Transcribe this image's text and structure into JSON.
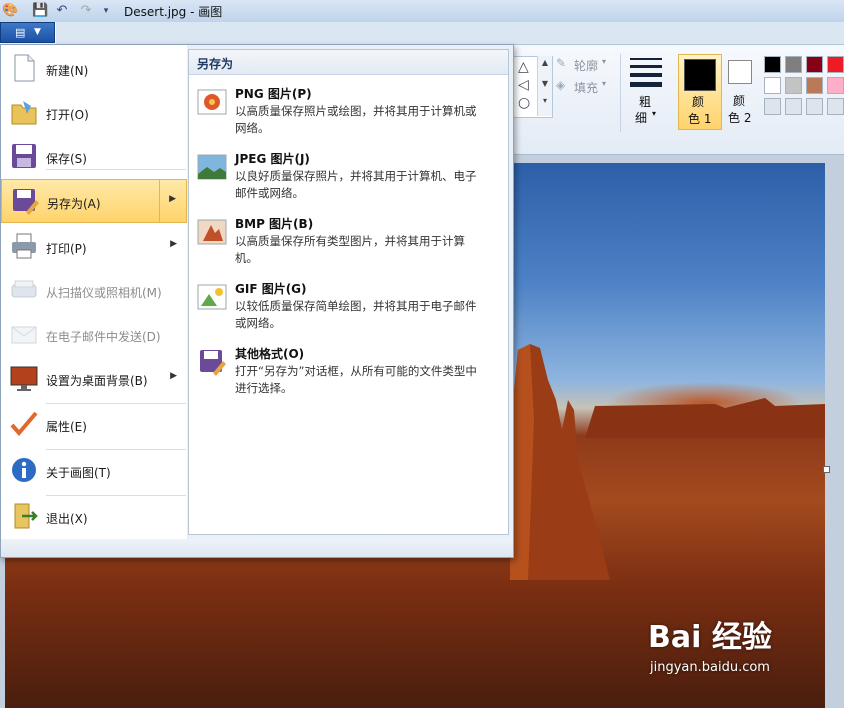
{
  "window": {
    "title": "Desert.jpg - 画图"
  },
  "quick_access": {
    "save_icon": "save-icon",
    "undo_icon": "undo-icon",
    "redo_icon": "redo-icon",
    "customize_icon": "chevron-down-icon"
  },
  "ribbon": {
    "outline_label": "轮廓",
    "fill_label": "填充",
    "size_label_1": "粗",
    "size_label_2": "细",
    "color1_label_1": "颜",
    "color1_label_2": "色 1",
    "color2_label_1": "颜",
    "color2_label_2": "色 2",
    "palette": [
      "#000000",
      "#7f7f7f",
      "#880015",
      "#ed1c24",
      "#ffffff",
      "#c3c3c3",
      "#b97a57",
      "#ffaec9",
      "#dde4ec",
      "#dde4ec",
      "#dde4ec",
      "#dde4ec"
    ],
    "color1": "#000000",
    "color2": "#ffffff"
  },
  "app_menu": {
    "items": [
      {
        "label": "新建(N)",
        "icon": "new-file-icon",
        "enabled": true
      },
      {
        "label": "打开(O)",
        "icon": "open-folder-icon",
        "enabled": true
      },
      {
        "label": "保存(S)",
        "icon": "save-icon",
        "enabled": true
      },
      {
        "label": "另存为(A)",
        "icon": "save-as-icon",
        "enabled": true,
        "active": true
      },
      {
        "label": "打印(P)",
        "icon": "printer-icon",
        "enabled": true
      },
      {
        "label": "从扫描仪或照相机(M)",
        "icon": "scanner-icon",
        "enabled": false
      },
      {
        "label": "在电子邮件中发送(D)",
        "icon": "email-icon",
        "enabled": false
      },
      {
        "label": "设置为桌面背景(B)",
        "icon": "desktop-background-icon",
        "enabled": true
      },
      {
        "label": "属性(E)",
        "icon": "checkmark-icon",
        "enabled": true
      },
      {
        "label": "关于画图(T)",
        "icon": "info-icon",
        "enabled": true
      },
      {
        "label": "退出(X)",
        "icon": "exit-icon",
        "enabled": true
      }
    ],
    "submenu": {
      "title": "另存为",
      "items": [
        {
          "title": "PNG 图片(P)",
          "desc": "以高质量保存照片或绘图，并将其用于计算机或网络。",
          "icon": "png-image-icon"
        },
        {
          "title": "JPEG 图片(J)",
          "desc": "以良好质量保存照片，并将其用于计算机、电子邮件或网络。",
          "icon": "jpeg-image-icon"
        },
        {
          "title": "BMP 图片(B)",
          "desc": "以高质量保存所有类型图片，并将其用于计算机。",
          "icon": "bmp-image-icon"
        },
        {
          "title": "GIF 图片(G)",
          "desc": "以较低质量保存简单绘图，并将其用于电子邮件或网络。",
          "icon": "gif-image-icon"
        },
        {
          "title": "其他格式(O)",
          "desc": "打开“另存为”对话框，从所有可能的文件类型中进行选择。",
          "icon": "other-formats-icon"
        }
      ]
    }
  },
  "watermark": {
    "main": "Bai 经验",
    "sub": "jingyan.baidu.com"
  }
}
